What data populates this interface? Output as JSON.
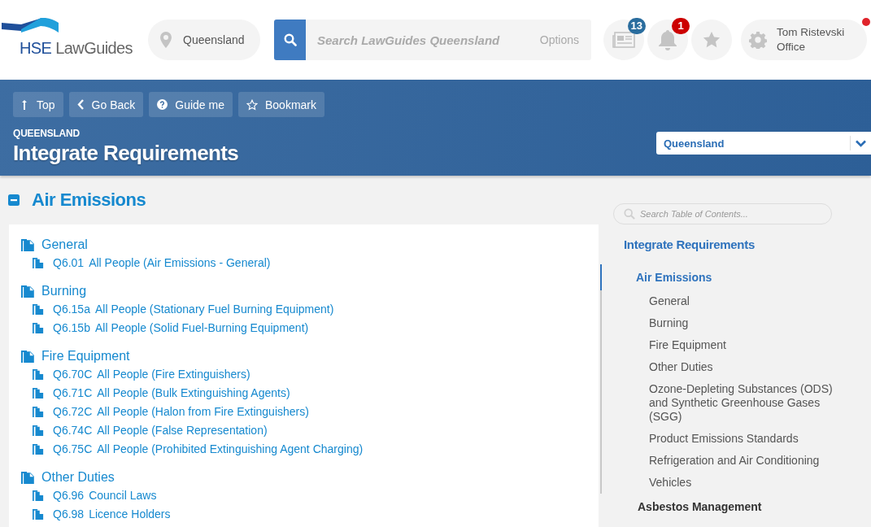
{
  "header": {
    "logo": {
      "brand": "HSE",
      "name": "LawGuides"
    },
    "location": "Queensland",
    "search": {
      "placeholder": "Search LawGuides Queensland",
      "options": "Options"
    },
    "icons": [
      {
        "kind": "news",
        "badge": "13",
        "color": "#2a6d9e"
      },
      {
        "kind": "bell",
        "badge": "1",
        "color": "#cc0000"
      },
      {
        "kind": "star"
      }
    ],
    "user": {
      "name": "Tom Ristevski",
      "role": "Office",
      "alert": true
    }
  },
  "toolbar": {
    "buttons": [
      {
        "kind": "top",
        "label": "Top"
      },
      {
        "kind": "back",
        "label": "Go Back"
      },
      {
        "kind": "help",
        "label": "Guide me"
      },
      {
        "kind": "bookmark",
        "label": "Bookmark"
      }
    ],
    "breadcrumb": "QUEENSLAND",
    "title": "Integrate Requirements",
    "region_select": "Queensland"
  },
  "section": {
    "title": "Air Emissions",
    "expanded": true,
    "groups": [
      {
        "title": "General",
        "items": [
          {
            "code": "Q6.01",
            "title": "All People (Air Emissions - General)"
          }
        ]
      },
      {
        "title": "Burning",
        "items": [
          {
            "code": "Q6.15a",
            "title": "All People (Stationary Fuel Burning Equipment)"
          },
          {
            "code": "Q6.15b",
            "title": "All People (Solid Fuel-Burning Equipment)"
          }
        ]
      },
      {
        "title": "Fire Equipment",
        "items": [
          {
            "code": "Q6.70C",
            "title": "All People (Fire Extinguishers)"
          },
          {
            "code": "Q6.71C",
            "title": "All People (Bulk Extinguishing Agents)"
          },
          {
            "code": "Q6.72C",
            "title": "All People (Halon from Fire Extinguishers)"
          },
          {
            "code": "Q6.74C",
            "title": "All People (False Representation)"
          },
          {
            "code": "Q6.75C",
            "title": "All People (Prohibited Extinguishing Agent Charging)"
          }
        ]
      },
      {
        "title": "Other Duties",
        "items": [
          {
            "code": "Q6.96",
            "title": "Council Laws"
          },
          {
            "code": "Q6.98",
            "title": "Licence Holders"
          }
        ]
      }
    ]
  },
  "toc": {
    "search_placeholder": "Search Table of Contents...",
    "title": "Integrate Requirements",
    "items": [
      {
        "label": "Air Emissions",
        "selected": true,
        "expanded": true,
        "children": [
          {
            "label": "General",
            "selected": false
          },
          {
            "label": "Burning",
            "selected": false
          },
          {
            "label": "Fire Equipment",
            "selected": false
          },
          {
            "label": "Other Duties",
            "selected": false
          },
          {
            "label": "Ozone-Depleting Substances (ODS) and Synthetic Greenhouse Gases (SGG)",
            "selected": false
          },
          {
            "label": "Product Emissions Standards",
            "selected": false
          },
          {
            "label": "Refrigeration and Air Conditioning",
            "selected": false
          },
          {
            "label": "Vehicles",
            "selected": false
          }
        ]
      },
      {
        "label": "Asbestos Management",
        "selected": false,
        "expanded": false
      }
    ]
  }
}
